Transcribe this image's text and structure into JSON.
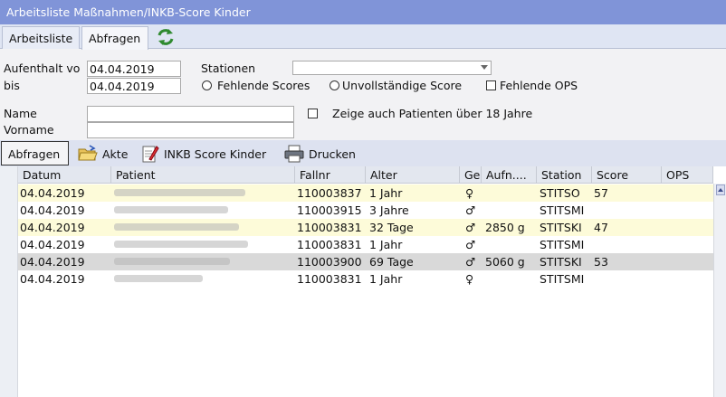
{
  "window": {
    "title": "Arbeitsliste Maßnahmen/INKB-Score Kinder"
  },
  "tabs": [
    {
      "label": "Arbeitsliste",
      "active": false
    },
    {
      "label": "Abfragen",
      "active": true
    }
  ],
  "filters": {
    "aufenthalt_label": "Aufenthalt vo",
    "aufenthalt_value": "04.04.2019",
    "bis_label": "bis",
    "bis_value": "04.04.2019",
    "stationen_label": "Stationen",
    "stationen_value": "",
    "fehlende_scores_label": "Fehlende Scores",
    "unvollstaendige_label": "Unvollständige Score",
    "fehlende_ops_label": "Fehlende OPS",
    "name_label": "Name",
    "name_value": "",
    "vorname_label": "Vorname",
    "vorname_value": "",
    "ueber18_label": "Zeige auch Patienten über 18 Jahre"
  },
  "toolbar": {
    "abfragen_label": "Abfragen",
    "akte_label": "Akte",
    "inkb_label": "INKB Score Kinder",
    "drucken_label": "Drucken"
  },
  "table": {
    "columns": [
      "Datum",
      "Patient",
      "Fallnr",
      "Alter",
      "Ge",
      "Aufn....",
      "Station",
      "Score",
      "OPS"
    ],
    "rows": [
      {
        "datum": "04.04.2019",
        "fallnr": "110003837",
        "alter": "1 Jahr",
        "sex": "♀",
        "aufn": "",
        "station": "STITSO",
        "score": "57",
        "ops": "",
        "bg": "#fdfbd9"
      },
      {
        "datum": "04.04.2019",
        "fallnr": "110003915",
        "alter": "3 Jahre",
        "sex": "♂",
        "aufn": "",
        "station": "STITSMI",
        "score": "",
        "ops": "",
        "bg": "#ffffff"
      },
      {
        "datum": "04.04.2019",
        "fallnr": "110003831",
        "alter": "32 Tage",
        "sex": "♂",
        "aufn": "2850 g",
        "station": "STITSKI",
        "score": "47",
        "ops": "",
        "bg": "#fdfbd9"
      },
      {
        "datum": "04.04.2019",
        "fallnr": "110003831",
        "alter": "1 Jahr",
        "sex": "♂",
        "aufn": "",
        "station": "STITSMI",
        "score": "",
        "ops": "",
        "bg": "#ffffff"
      },
      {
        "datum": "04.04.2019",
        "fallnr": "110003900",
        "alter": "69 Tage",
        "sex": "♂",
        "aufn": "5060 g",
        "station": "STITSKI",
        "score": "53",
        "ops": "",
        "bg": "#d9d9d9"
      },
      {
        "datum": "04.04.2019",
        "fallnr": "110003831",
        "alter": "1 Jahr",
        "sex": "♀",
        "aufn": "",
        "station": "STITSMI",
        "score": "",
        "ops": "",
        "bg": "#ffffff"
      }
    ]
  },
  "colors": {
    "title_bar": "#8094d8",
    "row_highlight": "#fdfbd9",
    "row_selected": "#d9d9d9"
  }
}
